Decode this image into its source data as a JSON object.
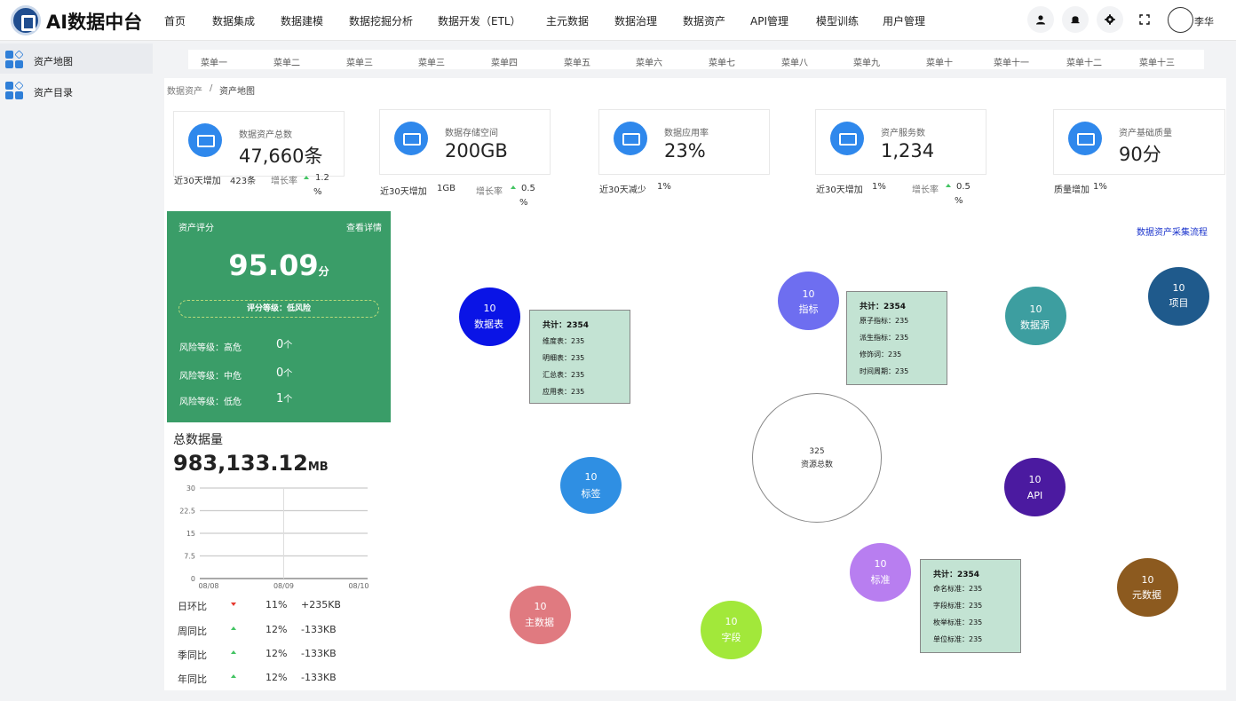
{
  "app": {
    "title": "AI数据中台",
    "user": "李华"
  },
  "topnav": [
    "首页",
    "数据集成",
    "数据建模",
    "数据挖掘分析",
    "数据开发（ETL）",
    "主元数据",
    "数据治理",
    "数据资产",
    "API管理",
    "模型训练",
    "用户管理"
  ],
  "header_icons": [
    "user-icon",
    "bell-icon",
    "gear-icon",
    "fullscreen-icon"
  ],
  "sidebar": [
    {
      "label": "资产地图",
      "icon": "grid-icon"
    },
    {
      "label": "资产目录",
      "icon": "grid-icon"
    }
  ],
  "menu_tabs": [
    "菜单一",
    "菜单二",
    "菜单三",
    "菜单三",
    "菜单四",
    "菜单五",
    "菜单六",
    "菜单七",
    "菜单八",
    "菜单九",
    "菜单十",
    "菜单十一",
    "菜单十二",
    "菜单十三"
  ],
  "breadcrumb": {
    "parent": "数据资产",
    "sep": "/",
    "current": "资产地图"
  },
  "stats": [
    {
      "title": "数据资产总数",
      "value": "47,660条",
      "foot_label": "近30天增加",
      "foot_value": "423条",
      "rate_label": "增长率",
      "rate": "1.2",
      "rate_unit": "%"
    },
    {
      "title": "数据存储空间",
      "value": "200GB",
      "foot_label": "近30天增加",
      "foot_value": "1GB",
      "rate_label": "增长率",
      "rate": "0.5",
      "rate_unit": "%"
    },
    {
      "title": "数据应用率",
      "value": "23%",
      "foot_label": "近30天减少",
      "foot_value": "1%"
    },
    {
      "title": "资产服务数",
      "value": "1,234",
      "foot_label": "近30天增加",
      "foot_value": "1%",
      "rate_label": "增长率",
      "rate": "0.5",
      "rate_unit": "%"
    },
    {
      "title": "资产基础质量",
      "value": "90分",
      "foot_label": "质量增加",
      "foot_value": "1%"
    }
  ],
  "score": {
    "title": "资产评分",
    "link": "查看详情",
    "value": "95.09",
    "unit": "分",
    "grade": "评分等级：低风险",
    "risks": [
      {
        "label": "风险等级：高危",
        "count": "0",
        "unit": "个"
      },
      {
        "label": "风险等级：中危",
        "count": "0",
        "unit": "个"
      },
      {
        "label": "风险等级：低危",
        "count": "1",
        "unit": "个"
      }
    ]
  },
  "volume": {
    "title": "总数据量",
    "value": "983,133.12",
    "unit": "MB"
  },
  "chart_data": {
    "type": "line",
    "categories": [
      "08/08",
      "08/09",
      "08/10"
    ],
    "y_ticks": [
      "30",
      "22.5",
      "15",
      "7.5",
      "0"
    ],
    "ylim": [
      0,
      30
    ],
    "grid": true,
    "series": []
  },
  "comparisons": [
    {
      "label": "日环比",
      "dir": "down",
      "pct": "11%",
      "delta": "+235KB"
    },
    {
      "label": "周同比",
      "dir": "up",
      "pct": "12%",
      "delta": "-133KB"
    },
    {
      "label": "季同比",
      "dir": "up",
      "pct": "12%",
      "delta": "-133KB"
    },
    {
      "label": "年同比",
      "dir": "up",
      "pct": "12%",
      "delta": "-133KB"
    }
  ],
  "flow_link": "数据资产采集流程",
  "center": {
    "value": "325",
    "label": "资源总数"
  },
  "bubbles": [
    {
      "count": "10",
      "label": "数据表",
      "color": "#0a14e6"
    },
    {
      "count": "10",
      "label": "指标",
      "color": "#6e6ef0"
    },
    {
      "count": "10",
      "label": "数据源",
      "color": "#3d9ea0"
    },
    {
      "count": "10",
      "label": "项目",
      "color": "#1f5a8c"
    },
    {
      "count": "10",
      "label": "标签",
      "color": "#2f8fe3"
    },
    {
      "count": "10",
      "label": "API",
      "color": "#4b1aa0"
    },
    {
      "count": "10",
      "label": "标准",
      "color": "#b87ef0"
    },
    {
      "count": "10",
      "label": "元数据",
      "color": "#8c5a1f"
    },
    {
      "count": "10",
      "label": "主数据",
      "color": "#e07a80"
    },
    {
      "count": "10",
      "label": "字段",
      "color": "#a2e83a"
    }
  ],
  "tips": [
    {
      "total": "共计：2354",
      "items": [
        "维度表：235",
        "明细表：235",
        "汇总表：235",
        "应用表：235"
      ]
    },
    {
      "total": "共计：2354",
      "items": [
        "原子指标：235",
        "派生指标：235",
        "修饰词：235",
        "时间周期：235"
      ]
    },
    {
      "total": "共计：2354",
      "items": [
        "命名标准：235",
        "字段标准：235",
        "枚举标准：235",
        "单位标准：235"
      ]
    }
  ]
}
